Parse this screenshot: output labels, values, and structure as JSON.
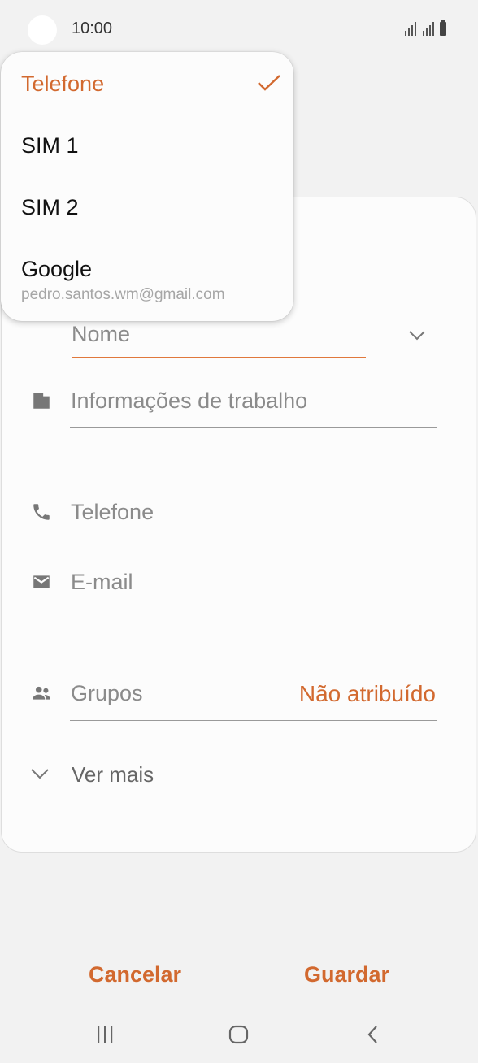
{
  "status_bar": {
    "time": "10:00",
    "icons": [
      "signal-icon",
      "signal-icon",
      "battery-icon"
    ]
  },
  "dropdown": {
    "items": [
      {
        "label": "Telefone",
        "selected": true
      },
      {
        "label": "SIM 1",
        "selected": false
      },
      {
        "label": "SIM 2",
        "selected": false
      },
      {
        "label": "Google",
        "selected": false,
        "sublabel": "pedro.santos.wm@gmail.com"
      }
    ]
  },
  "form": {
    "name_placeholder": "Nome",
    "work_placeholder": "Informações de trabalho",
    "phone_placeholder": "Telefone",
    "email_placeholder": "E-mail",
    "groups_label": "Grupos",
    "groups_value": "Não atribuído",
    "see_more": "Ver mais"
  },
  "actions": {
    "cancel": "Cancelar",
    "save": "Guardar"
  },
  "colors": {
    "accent": "#d2692f",
    "background": "#f2f2f2",
    "card": "#fcfcfc"
  },
  "nav_bar": [
    "recents-icon",
    "home-icon",
    "back-icon"
  ]
}
